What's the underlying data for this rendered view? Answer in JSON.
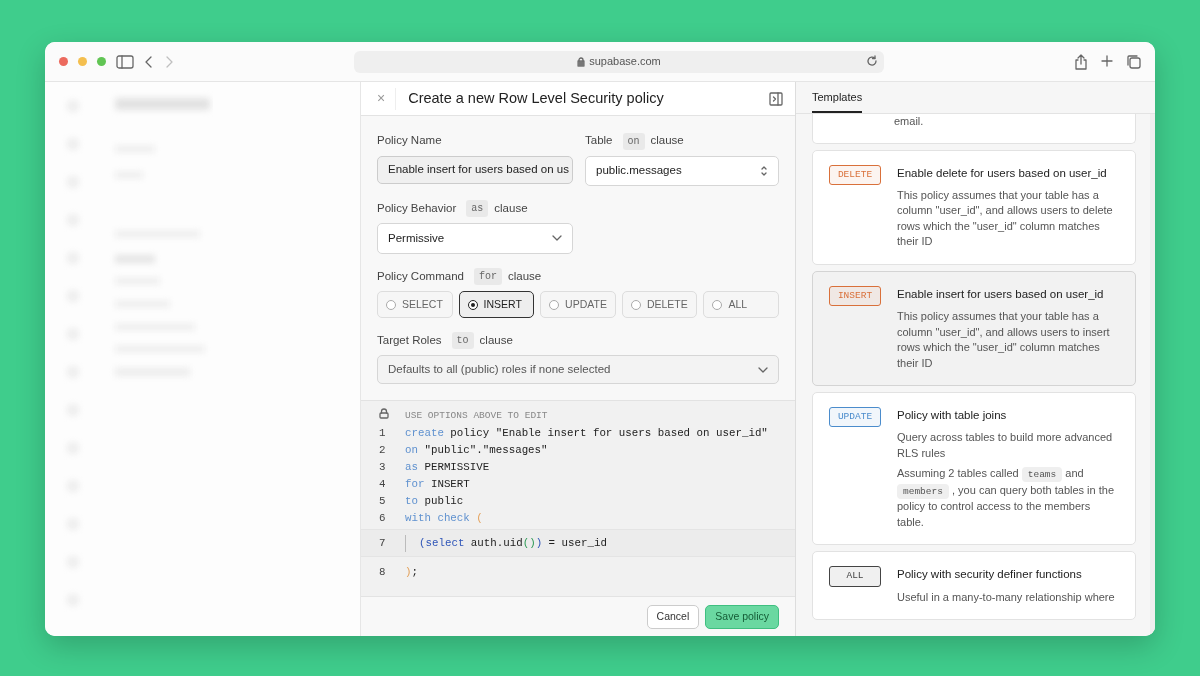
{
  "browser": {
    "address": "supabase.com",
    "forward_disabled": true
  },
  "panel": {
    "close": "×",
    "title": "Create a new Row Level Security policy",
    "policy_name": {
      "label": "Policy Name",
      "value": "Enable insert for users based on us"
    },
    "table": {
      "label": "Table",
      "clause_keyword": "on",
      "clause": "clause",
      "value": "public.messages"
    },
    "behavior": {
      "label": "Policy Behavior",
      "clause_keyword": "as",
      "clause": "clause",
      "value": "Permissive"
    },
    "command": {
      "label": "Policy Command",
      "clause_keyword": "for",
      "clause": "clause",
      "options": [
        {
          "label": "SELECT",
          "selected": false
        },
        {
          "label": "INSERT",
          "selected": true
        },
        {
          "label": "UPDATE",
          "selected": false
        },
        {
          "label": "DELETE",
          "selected": false
        },
        {
          "label": "ALL",
          "selected": false
        }
      ]
    },
    "roles": {
      "label": "Target Roles",
      "clause_keyword": "to",
      "clause": "clause",
      "placeholder": "Defaults to all (public) roles if none selected"
    },
    "editor": {
      "hint": "USE OPTIONS ABOVE TO EDIT",
      "lines": [
        {
          "number": "1",
          "active": false,
          "tokens": [
            {
              "kind": "keyword",
              "text": "create"
            },
            {
              "kind": "plain",
              "text": " policy \"Enable insert for users based on user_id\""
            }
          ]
        },
        {
          "number": "2",
          "active": false,
          "tokens": [
            {
              "kind": "keyword",
              "text": "on"
            },
            {
              "kind": "plain",
              "text": " \"public\".\"messages\""
            }
          ]
        },
        {
          "number": "3",
          "active": false,
          "tokens": [
            {
              "kind": "keyword",
              "text": "as"
            },
            {
              "kind": "plain",
              "text": " PERMISSIVE"
            }
          ]
        },
        {
          "number": "4",
          "active": false,
          "tokens": [
            {
              "kind": "keyword",
              "text": "for"
            },
            {
              "kind": "plain",
              "text": " INSERT"
            }
          ]
        },
        {
          "number": "5",
          "active": false,
          "tokens": [
            {
              "kind": "keyword",
              "text": "to"
            },
            {
              "kind": "plain",
              "text": " public"
            }
          ]
        },
        {
          "number": "6",
          "active": false,
          "tokens": [
            {
              "kind": "keyword",
              "text": "with check"
            },
            {
              "kind": "bracket",
              "text": " ("
            }
          ]
        },
        {
          "number": "7",
          "active": true,
          "tokens": [
            {
              "kind": "strong",
              "text": "(select"
            },
            {
              "kind": "plain",
              "text": " auth.uid"
            },
            {
              "kind": "call",
              "text": "()"
            },
            {
              "kind": "strong",
              "text": ")"
            },
            {
              "kind": "plain",
              "text": " = user_id"
            }
          ]
        },
        {
          "number": "8",
          "active": false,
          "tokens": [
            {
              "kind": "bracket",
              "text": ")"
            },
            {
              "kind": "plain",
              "text": ";"
            }
          ]
        }
      ]
    },
    "buttons": [
      {
        "kind": "secondary",
        "label": "Cancel"
      },
      {
        "kind": "primary",
        "label": "Save policy"
      }
    ]
  },
  "templates": {
    "tab": "Templates",
    "partial_text": "email.",
    "cards": [
      {
        "tag": "DELETE",
        "color": "#d9703a",
        "selected": false,
        "title": "Enable delete for users based on user_id",
        "paragraphs": [
          [
            {
              "kind": "text",
              "text": "This policy assumes that your table has a column \"user_id\", and allows users to delete rows which the \"user_id\" column matches their ID"
            }
          ]
        ]
      },
      {
        "tag": "INSERT",
        "color": "#d9703a",
        "selected": true,
        "title": "Enable insert for users based on user_id",
        "paragraphs": [
          [
            {
              "kind": "text",
              "text": "This policy assumes that your table has a column \"user_id\", and allows users to insert rows which the \"user_id\" column matches their ID"
            }
          ]
        ]
      },
      {
        "tag": "UPDATE",
        "color": "#4b8ccc",
        "selected": false,
        "title": "Policy with table joins",
        "paragraphs": [
          [
            {
              "kind": "text",
              "text": "Query across tables to build more advanced RLS rules"
            }
          ],
          [
            {
              "kind": "text",
              "text": "Assuming 2 tables called "
            },
            {
              "kind": "code",
              "text": "teams"
            },
            {
              "kind": "text",
              "text": " and "
            },
            {
              "kind": "code",
              "text": "members"
            },
            {
              "kind": "text",
              "text": " , you can query both tables in the policy to control access to the members table."
            }
          ]
        ]
      },
      {
        "tag": "ALL",
        "color": "#444444",
        "selected": false,
        "title": "Policy with security definer functions",
        "paragraphs": [
          [
            {
              "kind": "text",
              "text": "Useful in a many-to-many relationship where"
            }
          ]
        ]
      }
    ]
  }
}
